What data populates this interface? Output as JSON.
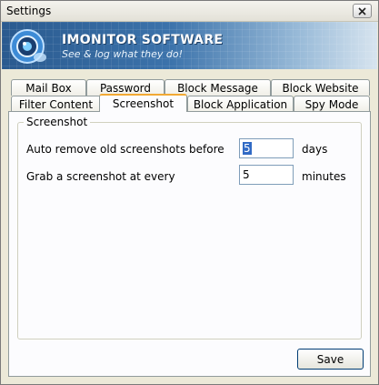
{
  "window": {
    "title": "Settings"
  },
  "banner": {
    "brand": "IMONITOR SOFTWARE",
    "slogan": "See & log what they do!",
    "colors": {
      "start": "#2a5a8f",
      "end": "#d7e4ef"
    }
  },
  "tabs": {
    "row_back": [
      {
        "label": "Mail Box"
      },
      {
        "label": "Password"
      },
      {
        "label": "Block Message"
      },
      {
        "label": "Block Website"
      }
    ],
    "row_front": [
      {
        "label": "Filter Content"
      },
      {
        "label": "Screenshot",
        "active": true
      },
      {
        "label": "Block Application"
      },
      {
        "label": "Spy Mode"
      }
    ]
  },
  "screenshot_group": {
    "title": "Screenshot",
    "auto_remove": {
      "label": "Auto remove old screenshots before",
      "value": "5",
      "unit": "days"
    },
    "grab_interval": {
      "label": "Grab a screenshot at every",
      "value": "5",
      "unit": "minutes"
    }
  },
  "actions": {
    "save_label": "Save"
  },
  "icons": {
    "close": "close-icon",
    "logo": "webcam-logo-icon"
  }
}
